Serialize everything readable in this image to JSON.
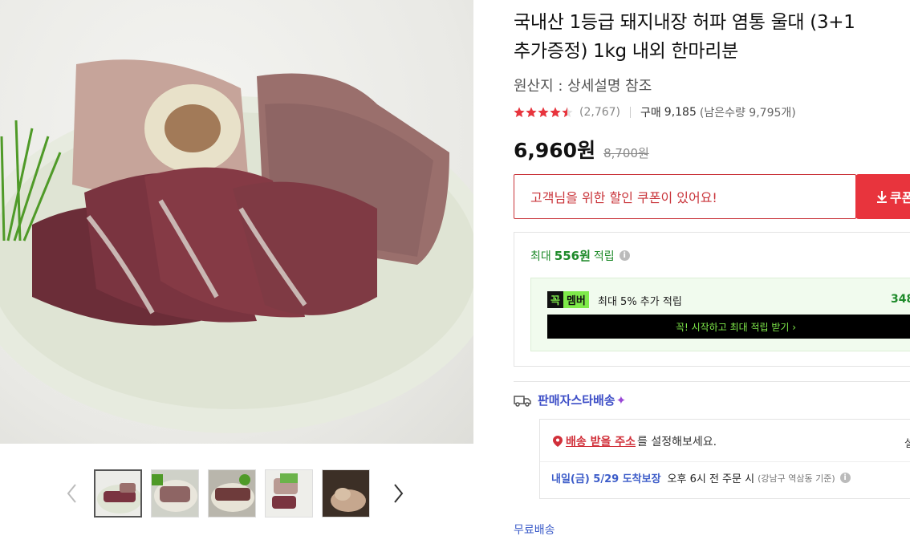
{
  "product": {
    "title_line1": "국내산 1등급 돼지내장 허파 염통 울대 (3+1",
    "title_line2": "추가증정) 1kg 내외 한마리분",
    "origin": "원산지 : 상세설명 참조",
    "rating": 4.5,
    "rating_count": "(2,767)",
    "purchase_label": "구매",
    "purchase_count": "9,185",
    "stock_text": "(남은수량 9,795개)",
    "price": "6,960원",
    "original_price": "8,700원"
  },
  "coupon": {
    "message": "고객님을 위한 할인 쿠폰이 있어요!",
    "button_label": "쿠폰"
  },
  "reward": {
    "prefix": "최대",
    "amount": "556원",
    "suffix": "적립",
    "member": {
      "badge_dark": "꼭",
      "badge_light": "멤버",
      "text": "최대 5% 추가 적립",
      "amount": "348",
      "cta": "꼭! 시작하고 최대 적립 받기 ›"
    }
  },
  "shipping": {
    "type_label": "판매자스타배송",
    "star": "✦",
    "address_link": "배송 받을 주소",
    "address_text": "를 설정해보세요.",
    "address_right": "설",
    "arrival_date": "내일(금) 5/29 도착보장",
    "arrival_condition": "오후 6시 전 주문 시",
    "arrival_basis": "(강남구 역삼동 기준)",
    "free_label": "무료배송"
  },
  "gallery": {
    "thumbnails": [
      "thumb-1",
      "thumb-2",
      "thumb-3",
      "thumb-4",
      "thumb-5"
    ],
    "active_index": 0
  },
  "colors": {
    "accent_red": "#e8343d",
    "reward_green": "#1e8a2a",
    "shipping_blue": "#3d4ec7",
    "member_neon": "#7fea4a"
  },
  "icons": {
    "star": "star-icon",
    "info": "info-icon",
    "download": "download-icon",
    "truck": "truck-icon",
    "pin": "location-pin-icon",
    "prev": "chevron-left-icon",
    "next": "chevron-right-icon"
  }
}
